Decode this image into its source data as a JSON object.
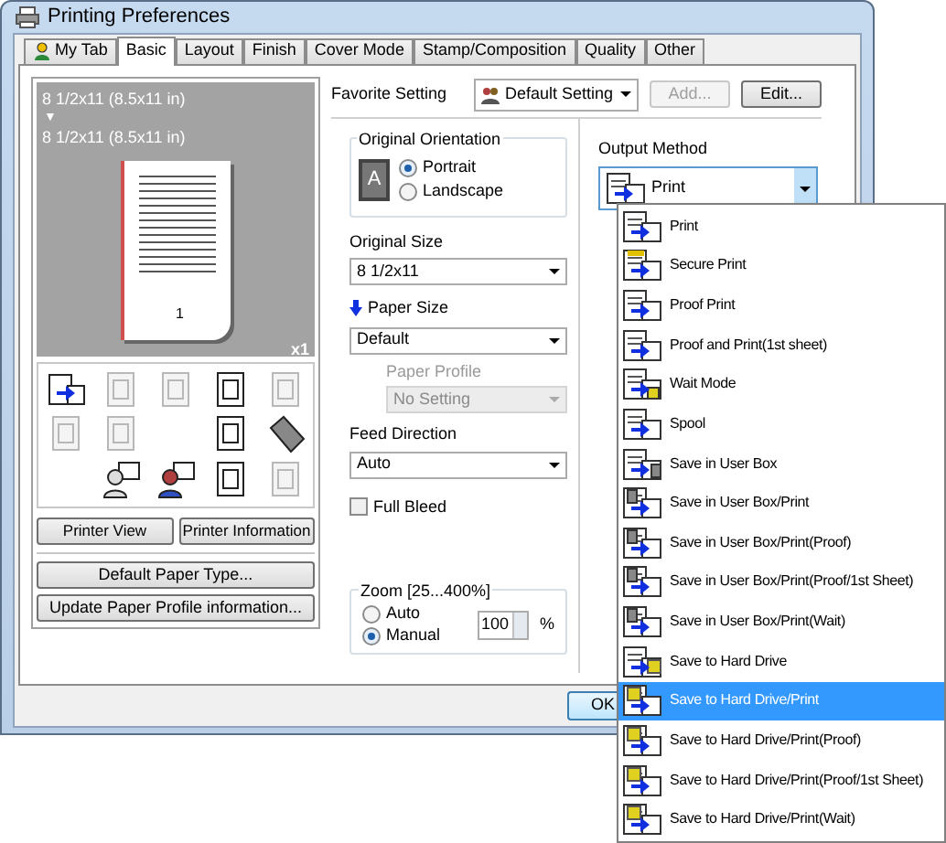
{
  "window": {
    "title": "Printing Preferences"
  },
  "tabs": [
    {
      "label": "My Tab",
      "selected": false
    },
    {
      "label": "Basic",
      "selected": true
    },
    {
      "label": "Layout",
      "selected": false
    },
    {
      "label": "Finish",
      "selected": false
    },
    {
      "label": "Cover Mode",
      "selected": false
    },
    {
      "label": "Stamp/Composition",
      "selected": false
    },
    {
      "label": "Quality",
      "selected": false
    },
    {
      "label": "Other",
      "selected": false
    }
  ],
  "preview": {
    "original": "8 1/2x11 (8.5x11 in)",
    "arrow": "▼",
    "output": "8 1/2x11 (8.5x11 in)",
    "page_number": "1",
    "copies": "x1"
  },
  "tools": [
    {
      "kind": "output",
      "disabled": false
    },
    {
      "kind": "poster",
      "disabled": true
    },
    {
      "kind": "copies",
      "disabled": true
    },
    {
      "kind": "stack",
      "disabled": false
    },
    {
      "kind": "rotate",
      "disabled": true
    },
    {
      "kind": "pages",
      "disabled": true
    },
    {
      "kind": "booklet",
      "disabled": true
    },
    {
      "kind": "blank"
    },
    {
      "kind": "watermark",
      "disabled": false
    },
    {
      "kind": "fold",
      "disabled": false
    },
    {
      "kind": "blank"
    },
    {
      "kind": "user",
      "disabled": false
    },
    {
      "kind": "users",
      "disabled": false
    },
    {
      "kind": "staple",
      "disabled": false
    },
    {
      "kind": "frame",
      "disabled": true
    }
  ],
  "left_buttons": [
    "Printer View",
    "Printer Information"
  ],
  "bottom_left_buttons": [
    "Default Paper Type...",
    "Update Paper Profile information..."
  ],
  "favorite": {
    "label": "Favorite Setting",
    "value": "Default Setting",
    "add": {
      "label": "Add...",
      "disabled": true
    },
    "edit": {
      "label": "Edit...",
      "disabled": false
    }
  },
  "orientation": {
    "title": "Original Orientation",
    "icon_letter": "A",
    "options": [
      {
        "label": "Portrait",
        "selected": true
      },
      {
        "label": "Landscape",
        "selected": false
      }
    ]
  },
  "original_size": {
    "label": "Original Size",
    "value": "8 1/2x11"
  },
  "paper_size": {
    "label": "Paper Size",
    "value": "Default"
  },
  "paper_profile": {
    "label": "Paper Profile",
    "value": "No Setting",
    "disabled": true
  },
  "feed_direction": {
    "label": "Feed Direction",
    "value": "Auto"
  },
  "full_bleed": {
    "label": "Full Bleed",
    "checked": false
  },
  "zoom": {
    "title": "Zoom [25...400%]",
    "options": [
      {
        "label": "Auto",
        "selected": false
      },
      {
        "label": "Manual",
        "selected": true
      }
    ],
    "value": "100",
    "unit": "%"
  },
  "output_method": {
    "label": "Output Method",
    "value": "Print",
    "expanded": true,
    "items": [
      {
        "label": "Print",
        "kind": "print",
        "highlighted": false
      },
      {
        "label": "Secure Print",
        "kind": "secure",
        "highlighted": false
      },
      {
        "label": "Proof Print",
        "kind": "proof",
        "highlighted": false
      },
      {
        "label": "Proof and Print(1st sheet)",
        "kind": "proof",
        "highlighted": false
      },
      {
        "label": "Wait Mode",
        "kind": "wait",
        "highlighted": false
      },
      {
        "label": "Spool",
        "kind": "spool",
        "highlighted": false
      },
      {
        "label": "Save in User Box",
        "kind": "box",
        "highlighted": false
      },
      {
        "label": "Save in User Box/Print",
        "kind": "boxprint",
        "highlighted": false
      },
      {
        "label": "Save in User Box/Print(Proof)",
        "kind": "boxprint",
        "highlighted": false
      },
      {
        "label": "Save in User Box/Print(Proof/1st Sheet)",
        "kind": "boxprint",
        "highlighted": false
      },
      {
        "label": "Save in User Box/Print(Wait)",
        "kind": "boxprint",
        "highlighted": false
      },
      {
        "label": "Save to Hard Drive",
        "kind": "hdd",
        "highlighted": false
      },
      {
        "label": "Save to Hard Drive/Print",
        "kind": "hddprint",
        "highlighted": true
      },
      {
        "label": "Save to Hard Drive/Print(Proof)",
        "kind": "hddprint",
        "highlighted": false
      },
      {
        "label": "Save to Hard Drive/Print(Proof/1st Sheet)",
        "kind": "hddprint",
        "highlighted": false
      },
      {
        "label": "Save to Hard Drive/Print(Wait)",
        "kind": "hddprint",
        "highlighted": false
      }
    ]
  },
  "dialog_buttons": [
    "OK"
  ]
}
